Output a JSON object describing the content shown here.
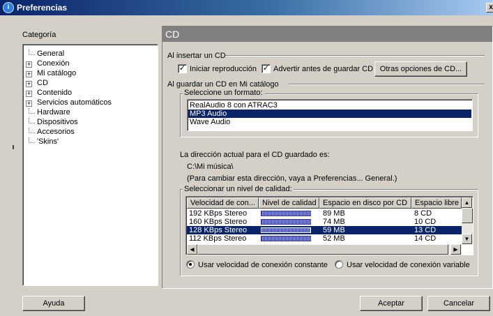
{
  "window": {
    "title": "Preferencias",
    "close_glyph": "x",
    "icon": "info-icon"
  },
  "sidebar": {
    "label": "Categoría",
    "items": [
      {
        "label": "General",
        "expandable": false
      },
      {
        "label": "Conexión",
        "expandable": true
      },
      {
        "label": "Mi catálogo",
        "expandable": true
      },
      {
        "label": "CD",
        "expandable": true
      },
      {
        "label": "Contenido",
        "expandable": true
      },
      {
        "label": "Servicios automáticos",
        "expandable": true
      },
      {
        "label": "Hardware",
        "expandable": false
      },
      {
        "label": "Dispositivos",
        "expandable": false
      },
      {
        "label": "Accesorios",
        "expandable": false
      },
      {
        "label": "'Skins'",
        "expandable": false
      }
    ]
  },
  "panel": {
    "header": "CD",
    "insert_group": {
      "label": "Al insertar un CD",
      "start_playback": {
        "label": "Iniciar reproducción",
        "checked": true
      },
      "warn_before_save": {
        "label": "Advertir antes de guardar CD",
        "checked": true
      },
      "more_options_button": "Otras opciones de CD..."
    },
    "save_group": {
      "label": "Al guardar un CD en Mi catálogo",
      "format_label": "Seleccione un formato:",
      "formats": [
        {
          "label": "RealAudio 8 con ATRAC3",
          "selected": false
        },
        {
          "label": "MP3 Audio",
          "selected": true
        },
        {
          "label": "Wave Audio",
          "selected": false
        }
      ],
      "current_address_label": "La dirección actual para el CD guardado es:",
      "current_address": "C:\\Mi música\\",
      "change_hint": "(Para cambiar esta dirección, vaya a Preferencias... General.)",
      "quality_label": "Seleccionar un nivel de calidad:",
      "quality_columns": [
        "Velocidad de con...",
        "Nivel de calidad",
        "Espacio en disco por CD",
        "Espacio libre e"
      ],
      "quality_rows": [
        {
          "speed": "192 KBps Stereo",
          "quality": 1.0,
          "disk": "89 MB",
          "free": "8 CD",
          "selected": false
        },
        {
          "speed": "160 KBps Stereo",
          "quality": 1.0,
          "disk": "74 MB",
          "free": "10 CD",
          "selected": false
        },
        {
          "speed": "128 KBps Stereo",
          "quality": 1.0,
          "disk": "59 MB",
          "free": "13 CD",
          "selected": true
        },
        {
          "speed": "112 KBps Stereo",
          "quality": 1.0,
          "disk": "52 MB",
          "free": "14 CD",
          "selected": false
        }
      ],
      "radio_constant": {
        "label": "Usar velocidad de conexión constante",
        "checked": true
      },
      "radio_variable": {
        "label": "Usar velocidad de conexión variable",
        "checked": false
      }
    }
  },
  "footer": {
    "help_button": "Ayuda",
    "ok_button": "Aceptar",
    "cancel_button": "Cancelar"
  }
}
